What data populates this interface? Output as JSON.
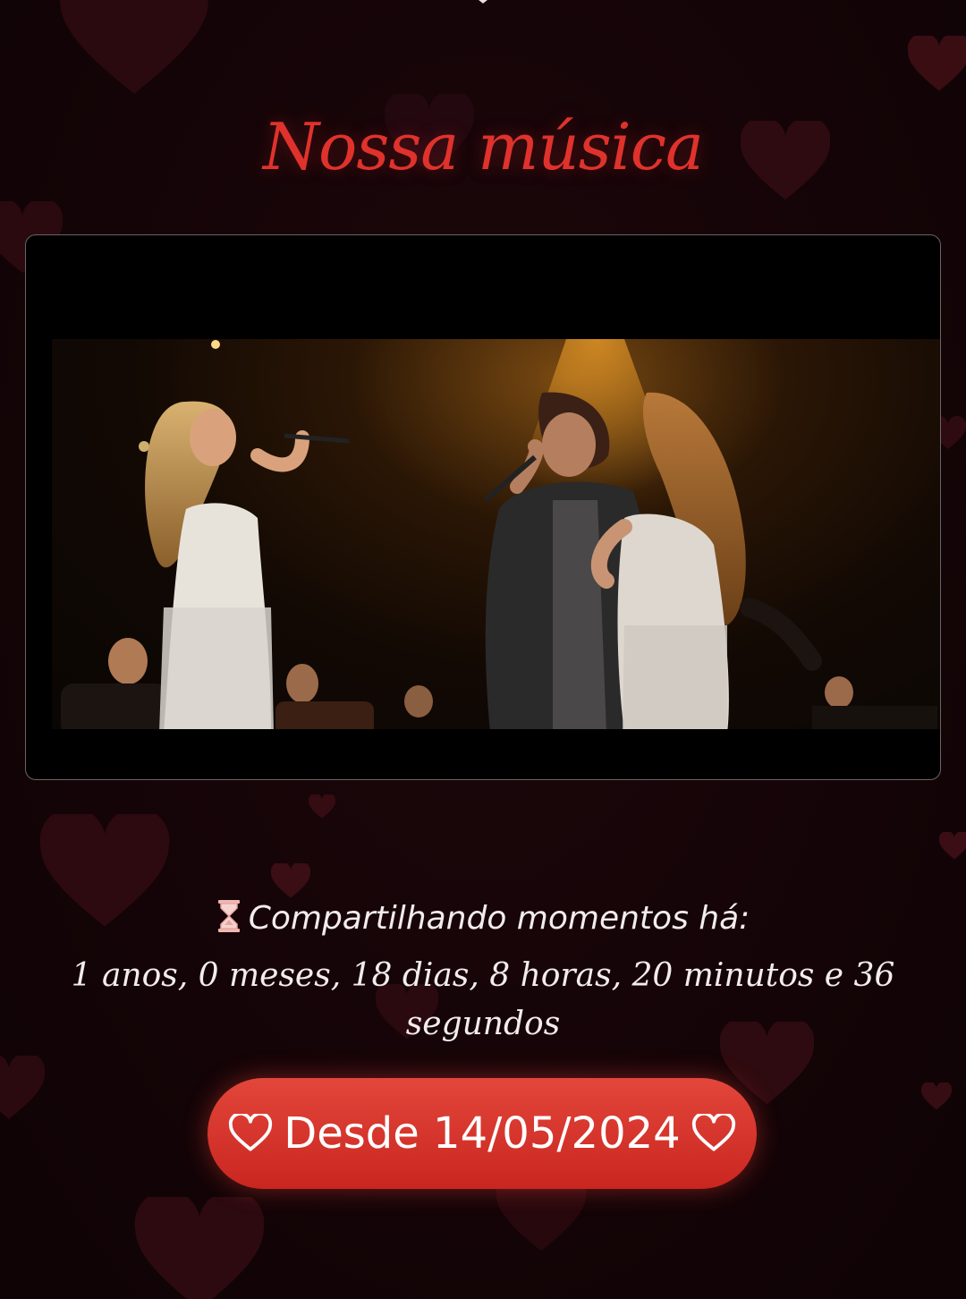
{
  "section": {
    "title": "Nossa música"
  },
  "video": {
    "icon": "video-player"
  },
  "timer": {
    "icon": "hourglass-icon",
    "label": "Compartilhando momentos há:",
    "value": "1 anos, 0 meses, 18 dias, 8 horas, 20 minutos e 36 segundos"
  },
  "since_button": {
    "label": "Desde 14/05/2024",
    "icon_left": "heart-outline-icon",
    "icon_right": "heart-outline-icon"
  },
  "colors": {
    "background": "#150508",
    "accent": "#e0322c",
    "button": "#d6352c",
    "text": "#f3ecec"
  }
}
